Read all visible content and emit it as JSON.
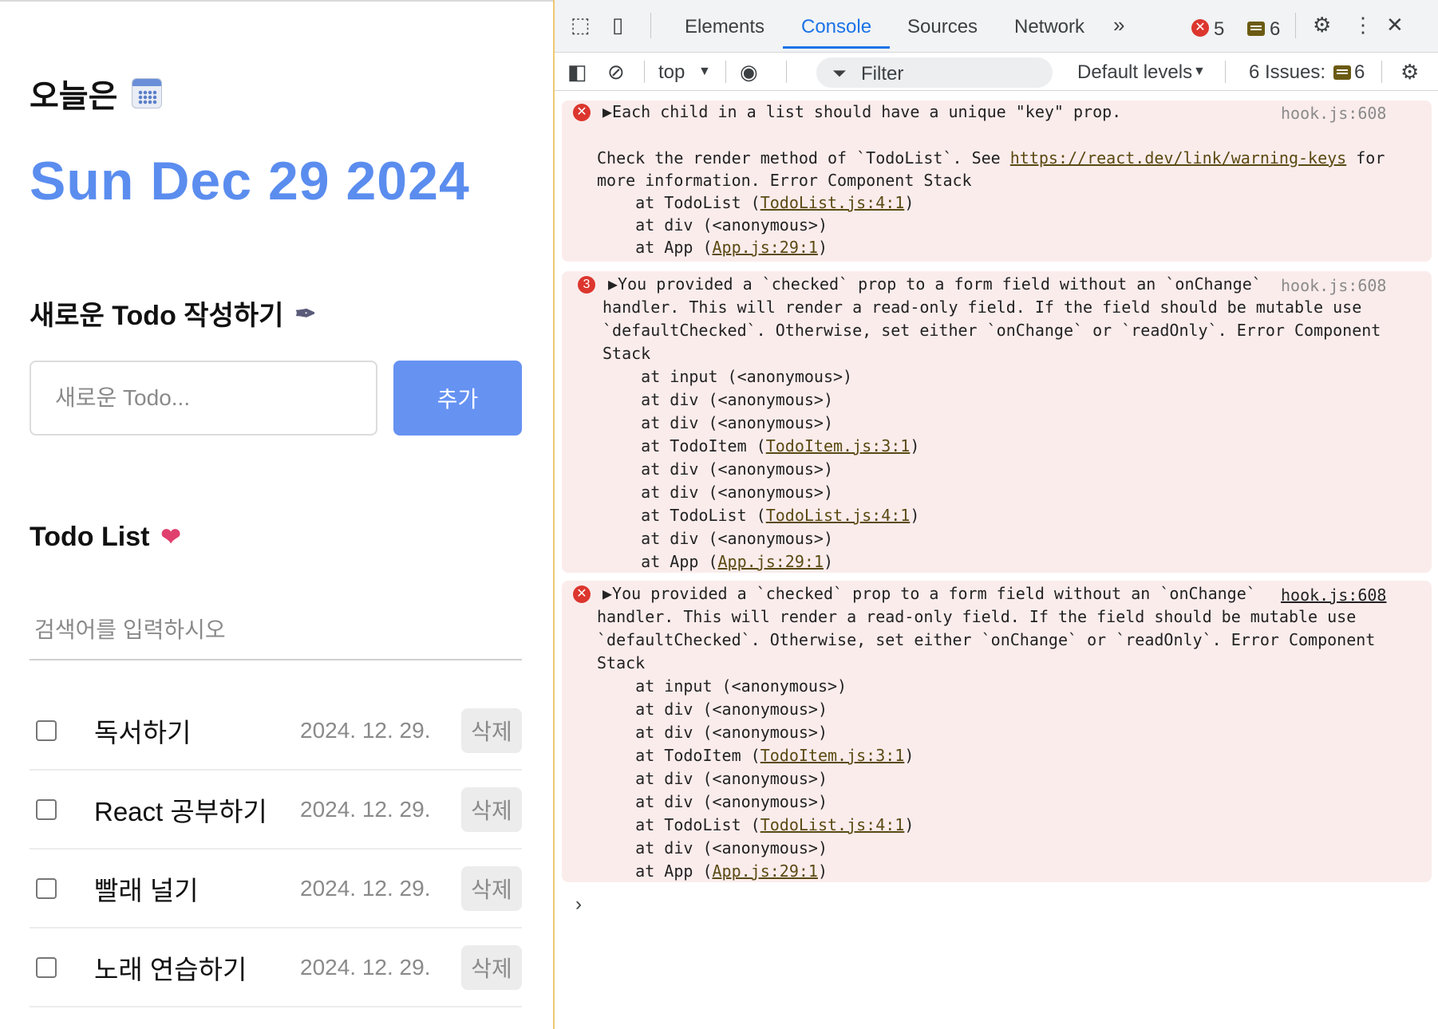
{
  "app": {
    "today_label": "오늘은",
    "date": "Sun Dec 29 2024",
    "editor_title": "새로운 Todo 작성하기",
    "new_placeholder": "새로운 Todo...",
    "add_button": "추가",
    "list_title": "Todo List",
    "search_placeholder": "검색어를 입력하시오",
    "todos": [
      {
        "text": "독서하기",
        "date": "2024. 12. 29.",
        "delete": "삭제"
      },
      {
        "text": "React 공부하기",
        "date": "2024. 12. 29.",
        "delete": "삭제"
      },
      {
        "text": "빨래 널기",
        "date": "2024. 12. 29.",
        "delete": "삭제"
      },
      {
        "text": "노래 연습하기",
        "date": "2024. 12. 29.",
        "delete": "삭제"
      }
    ]
  },
  "devtools": {
    "tabs": [
      "Elements",
      "Console",
      "Sources",
      "Network"
    ],
    "active_tab": "Console",
    "error_count": "5",
    "message_count": "6",
    "context": "top",
    "filter_placeholder": "Filter",
    "levels": "Default levels",
    "issues_label": "6 Issues:",
    "issues_count": "6",
    "messages": [
      {
        "icon": "✕",
        "source": "hook.js:608",
        "lines": [
          "▶Each child in a list should have a unique \"key\" prop.",
          "",
          "Check the render method of `TodoList`. See ",
          "more information. Error Component Stack",
          "    at TodoList (",
          "    at div (<anonymous>)",
          "    at App ("
        ],
        "warning_link": "https://react.dev/link/warning-keys",
        "for_text": " for",
        "links": [
          "TodoList.js:4:1",
          "App.js:29:1"
        ]
      },
      {
        "icon": "3",
        "source": "hook.js:608",
        "lines": [
          "▶You provided a `checked` prop to a form field without an `onChange`",
          "handler. This will render a read-only field. If the field should be mutable use",
          "`defaultChecked`. Otherwise, set either `onChange` or `readOnly`. Error Component",
          "Stack",
          "    at input (<anonymous>)",
          "    at div (<anonymous>)",
          "    at div (<anonymous>)",
          "    at TodoItem (",
          "    at div (<anonymous>)",
          "    at div (<anonymous>)",
          "    at TodoList (",
          "    at div (<anonymous>)",
          "    at App ("
        ],
        "links": [
          "TodoItem.js:3:1",
          "TodoList.js:4:1",
          "App.js:29:1"
        ]
      },
      {
        "icon": "✕",
        "source": "hook.js:608",
        "lines": [
          "▶You provided a `checked` prop to a form field without an `onChange`",
          "handler. This will render a read-only field. If the field should be mutable use",
          "`defaultChecked`. Otherwise, set either `onChange` or `readOnly`. Error Component",
          "Stack",
          "    at input (<anonymous>)",
          "    at div (<anonymous>)",
          "    at div (<anonymous>)",
          "    at TodoItem (",
          "    at div (<anonymous>)",
          "    at div (<anonymous>)",
          "    at TodoList (",
          "    at div (<anonymous>)",
          "    at App ("
        ],
        "links": [
          "TodoItem.js:3:1",
          "TodoList.js:4:1",
          "App.js:29:1"
        ]
      }
    ],
    "close_paren": ")",
    "prompt": "›"
  },
  "icons": {
    "calendar": "calendar-icon",
    "pen": "pen-icon",
    "heart": "heart-icon"
  }
}
